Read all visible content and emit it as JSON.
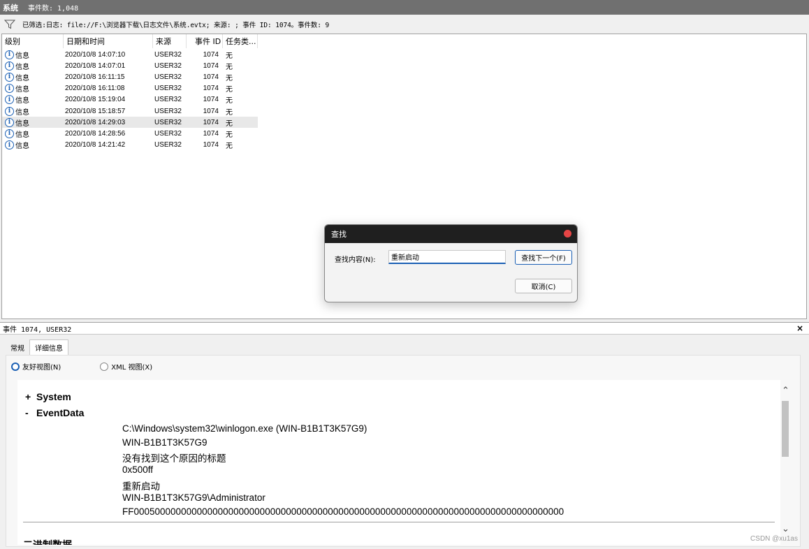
{
  "titlebar": {
    "name": "系统",
    "count_text": "事件数: 1,048"
  },
  "filter": {
    "text": "已筛选:日志: file://F:\\浏览器下载\\日志文件\\系统.evtx; 来源: ; 事件 ID: 1074。事件数: 9"
  },
  "list": {
    "columns": {
      "level": "级别",
      "date": "日期和时间",
      "source": "来源",
      "event_id": "事件 ID",
      "task": "任务类..."
    },
    "rows": [
      {
        "level": "信息",
        "date": "2020/10/8 14:07:10",
        "source": "USER32",
        "event_id": "1074",
        "task": "无"
      },
      {
        "level": "信息",
        "date": "2020/10/8 14:07:01",
        "source": "USER32",
        "event_id": "1074",
        "task": "无"
      },
      {
        "level": "信息",
        "date": "2020/10/8 16:11:15",
        "source": "USER32",
        "event_id": "1074",
        "task": "无"
      },
      {
        "level": "信息",
        "date": "2020/10/8 16:11:08",
        "source": "USER32",
        "event_id": "1074",
        "task": "无"
      },
      {
        "level": "信息",
        "date": "2020/10/8 15:19:04",
        "source": "USER32",
        "event_id": "1074",
        "task": "无"
      },
      {
        "level": "信息",
        "date": "2020/10/8 15:18:57",
        "source": "USER32",
        "event_id": "1074",
        "task": "无"
      },
      {
        "level": "信息",
        "date": "2020/10/8 14:29:03",
        "source": "USER32",
        "event_id": "1074",
        "task": "无"
      },
      {
        "level": "信息",
        "date": "2020/10/8 14:28:56",
        "source": "USER32",
        "event_id": "1074",
        "task": "无"
      },
      {
        "level": "信息",
        "date": "2020/10/8 14:21:42",
        "source": "USER32",
        "event_id": "1074",
        "task": "无"
      }
    ],
    "info_icon_glyph": "i"
  },
  "find_dialog": {
    "title": "查找",
    "label": "查找内容(N):",
    "value": "重新启动",
    "find_next": "查找下一个(F)",
    "cancel": "取消(C)"
  },
  "detail": {
    "header": "事件 1074, USER32",
    "close_glyph": "×",
    "tabs": [
      {
        "label": "常规"
      },
      {
        "label": "详细信息"
      }
    ],
    "radio_friendly": "友好视图(N)",
    "radio_xml": "XML 视图(X)",
    "nodes": {
      "system": {
        "sign": "+",
        "label": "System"
      },
      "eventdata": {
        "sign": "-",
        "label": "EventData"
      }
    },
    "event_data": [
      "C:\\Windows\\system32\\winlogon.exe (WIN-B1B1T3K57G9)",
      "WIN-B1B1T3K57G9",
      "没有找到这个原因的标题",
      "0x500ff",
      "重新启动",
      "WIN-B1B1T3K57G9\\Administrator",
      "FF0005000000000000000000000000000000000000000000000000000000000000000000000000000000"
    ],
    "cutoff_text": "二进制数据"
  },
  "watermark": "CSDN @xu1as"
}
